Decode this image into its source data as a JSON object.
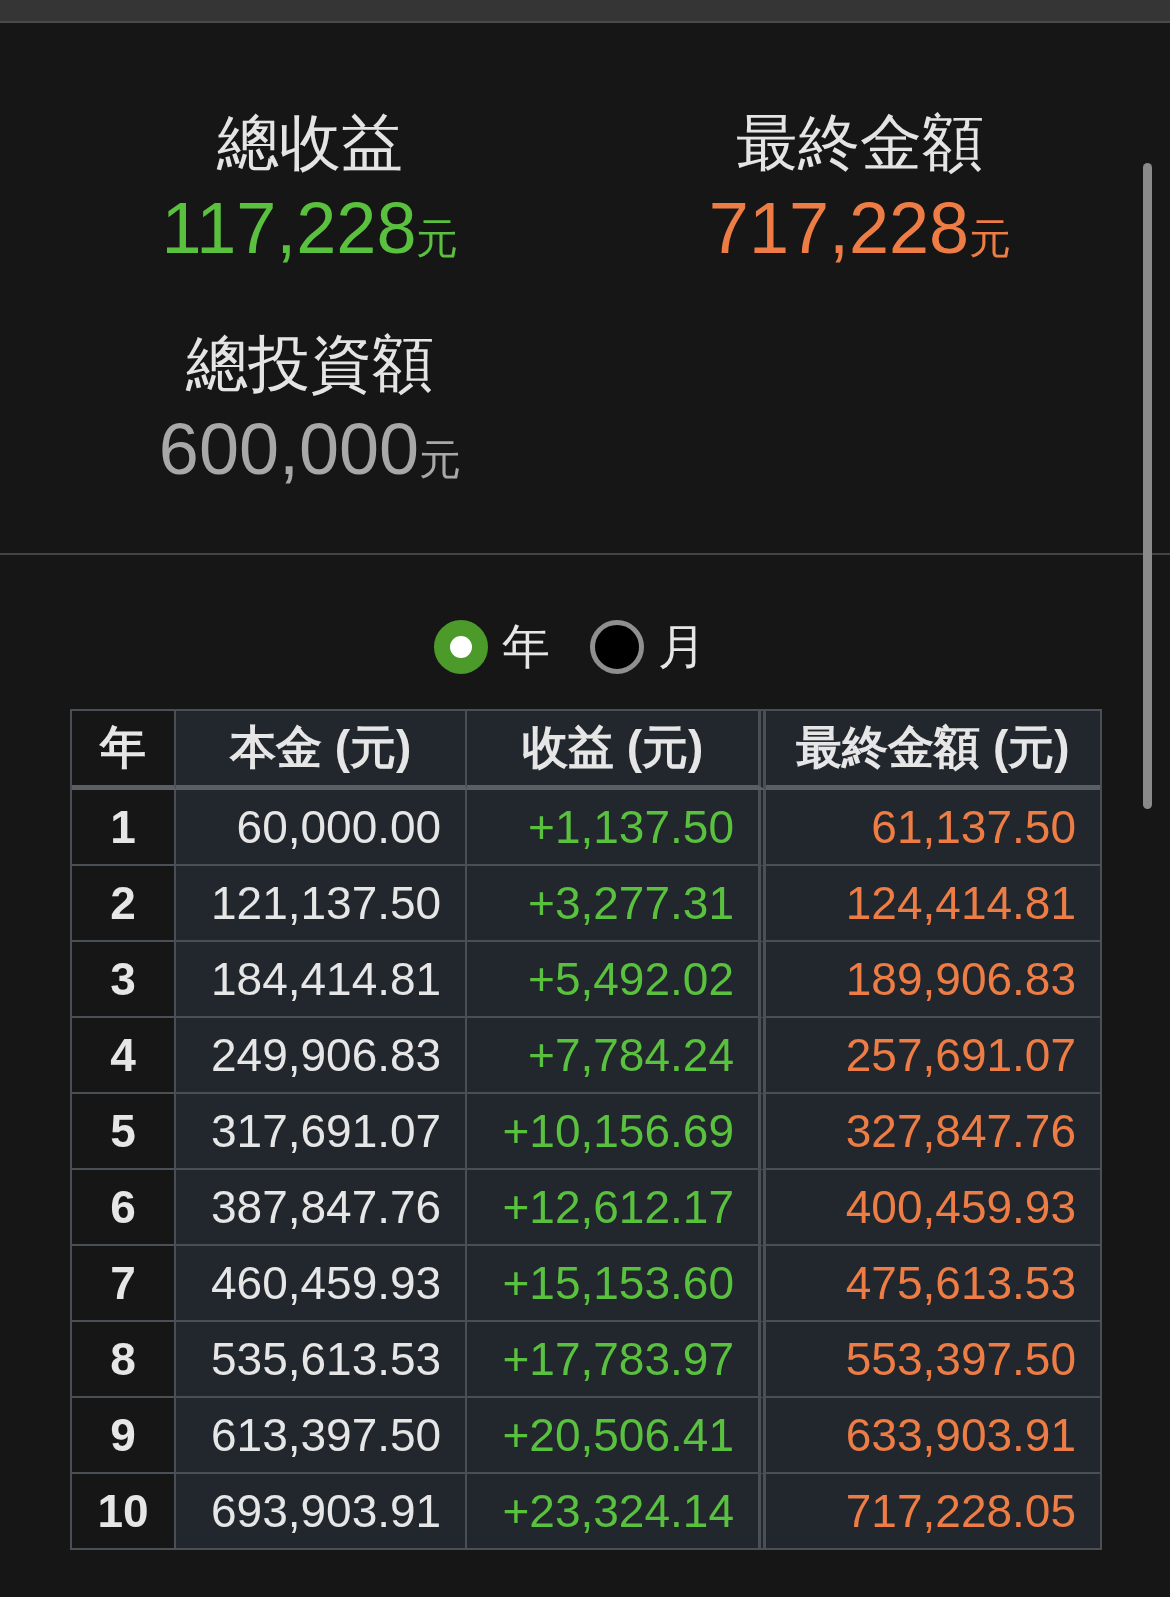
{
  "summary": [
    {
      "kind": "income",
      "label": "總收益",
      "value": "117,228",
      "unit": "元"
    },
    {
      "kind": "final",
      "label": "最終金額",
      "value": "717,228",
      "unit": "元"
    },
    {
      "kind": "invested",
      "label": "總投資額",
      "value": "600,000",
      "unit": "元"
    }
  ],
  "period_options": [
    {
      "label": "年",
      "selected": true
    },
    {
      "label": "月",
      "selected": false
    }
  ],
  "table": {
    "columns": [
      "年",
      "本金 (元)",
      "收益 (元)",
      "最終金額 (元)"
    ],
    "rows": [
      [
        "1",
        "60,000.00",
        "+1,137.50",
        "61,137.50"
      ],
      [
        "2",
        "121,137.50",
        "+3,277.31",
        "124,414.81"
      ],
      [
        "3",
        "184,414.81",
        "+5,492.02",
        "189,906.83"
      ],
      [
        "4",
        "249,906.83",
        "+7,784.24",
        "257,691.07"
      ],
      [
        "5",
        "317,691.07",
        "+10,156.69",
        "327,847.76"
      ],
      [
        "6",
        "387,847.76",
        "+12,612.17",
        "400,459.93"
      ],
      [
        "7",
        "460,459.93",
        "+15,153.60",
        "475,613.53"
      ],
      [
        "8",
        "535,613.53",
        "+17,783.97",
        "553,397.50"
      ],
      [
        "9",
        "613,397.50",
        "+20,506.41",
        "633,903.91"
      ],
      [
        "10",
        "693,903.91",
        "+23,324.14",
        "717,228.05"
      ]
    ]
  }
}
